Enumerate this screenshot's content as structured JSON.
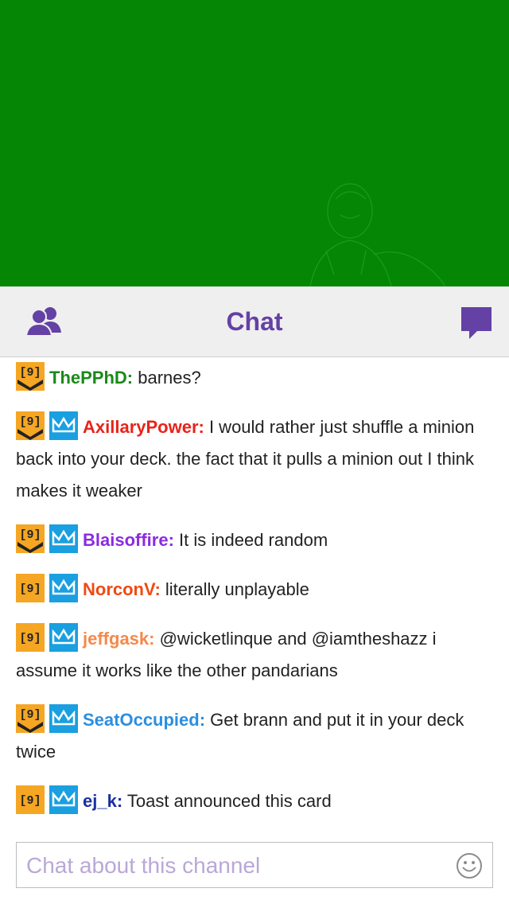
{
  "header": {
    "title": "Chat",
    "left_icon": "users-icon",
    "right_icon": "chat-bubble-icon"
  },
  "colors": {
    "brand": "#6441a4",
    "video_bg": "#058705",
    "sub_badge": "#f5a623",
    "crown_badge": "#1a9fe0"
  },
  "messages": [
    {
      "user": "ThePPhD:",
      "color": "#1a8a1a",
      "text": " barnes?",
      "badges": [
        "sub-badge"
      ]
    },
    {
      "user": "AxillaryPower:",
      "color": "#e8231a",
      "text": " I would rather just shuffle a minion back into your deck. the fact that it pulls a minion out I think makes it weaker",
      "badges": [
        "sub-badge",
        "crown-badge"
      ]
    },
    {
      "user": "Blaisoffire:",
      "color": "#8a2be2",
      "text": " It is indeed random",
      "badges": [
        "sub-badge",
        "crown-badge"
      ]
    },
    {
      "user": "NorconV:",
      "color": "#f04a12",
      "text": " literally unplayable",
      "badges": [
        "sub-badge-plain",
        "crown-badge"
      ]
    },
    {
      "user": "jeffgask:",
      "color": "#f5894a",
      "text": " @wicketlinque and @iamtheshazz i assume it works like the other pandarians",
      "badges": [
        "sub-badge-plain",
        "crown-badge"
      ]
    },
    {
      "user": "SeatOccupied:",
      "color": "#2b8fe0",
      "text": " Get brann and put it in your deck twice",
      "badges": [
        "sub-badge",
        "crown-badge"
      ]
    },
    {
      "user": "ej_k:",
      "color": "#1a2fa0",
      "text": " Toast announced this card",
      "badges": [
        "sub-badge-plain",
        "crown-badge"
      ]
    }
  ],
  "input": {
    "placeholder": "Chat about this channel",
    "value": "",
    "emoji_icon": "smiley-icon"
  }
}
